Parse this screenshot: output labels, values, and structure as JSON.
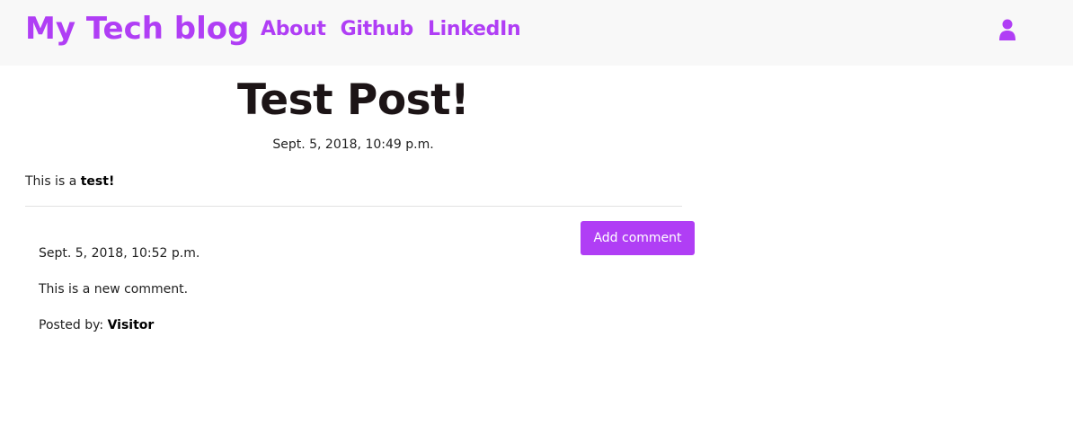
{
  "nav": {
    "brand": "My Tech blog",
    "links": [
      "About",
      "Github",
      "LinkedIn"
    ]
  },
  "colors": {
    "accent": "#b03ef5",
    "navbar_bg": "#f8f8f8",
    "title": "#1c1416"
  },
  "post": {
    "title": "Test Post!",
    "date": "Sept. 5, 2018, 10:49 p.m.",
    "body_prefix": "This is a ",
    "body_bold": "test!"
  },
  "comments_section": {
    "add_button_label": "Add comment",
    "comments": [
      {
        "date": "Sept. 5, 2018, 10:52 p.m.",
        "text": "This is a new comment.",
        "posted_by_label": "Posted by: ",
        "author": "Visitor"
      }
    ]
  },
  "icons": {
    "user": "user-icon"
  }
}
